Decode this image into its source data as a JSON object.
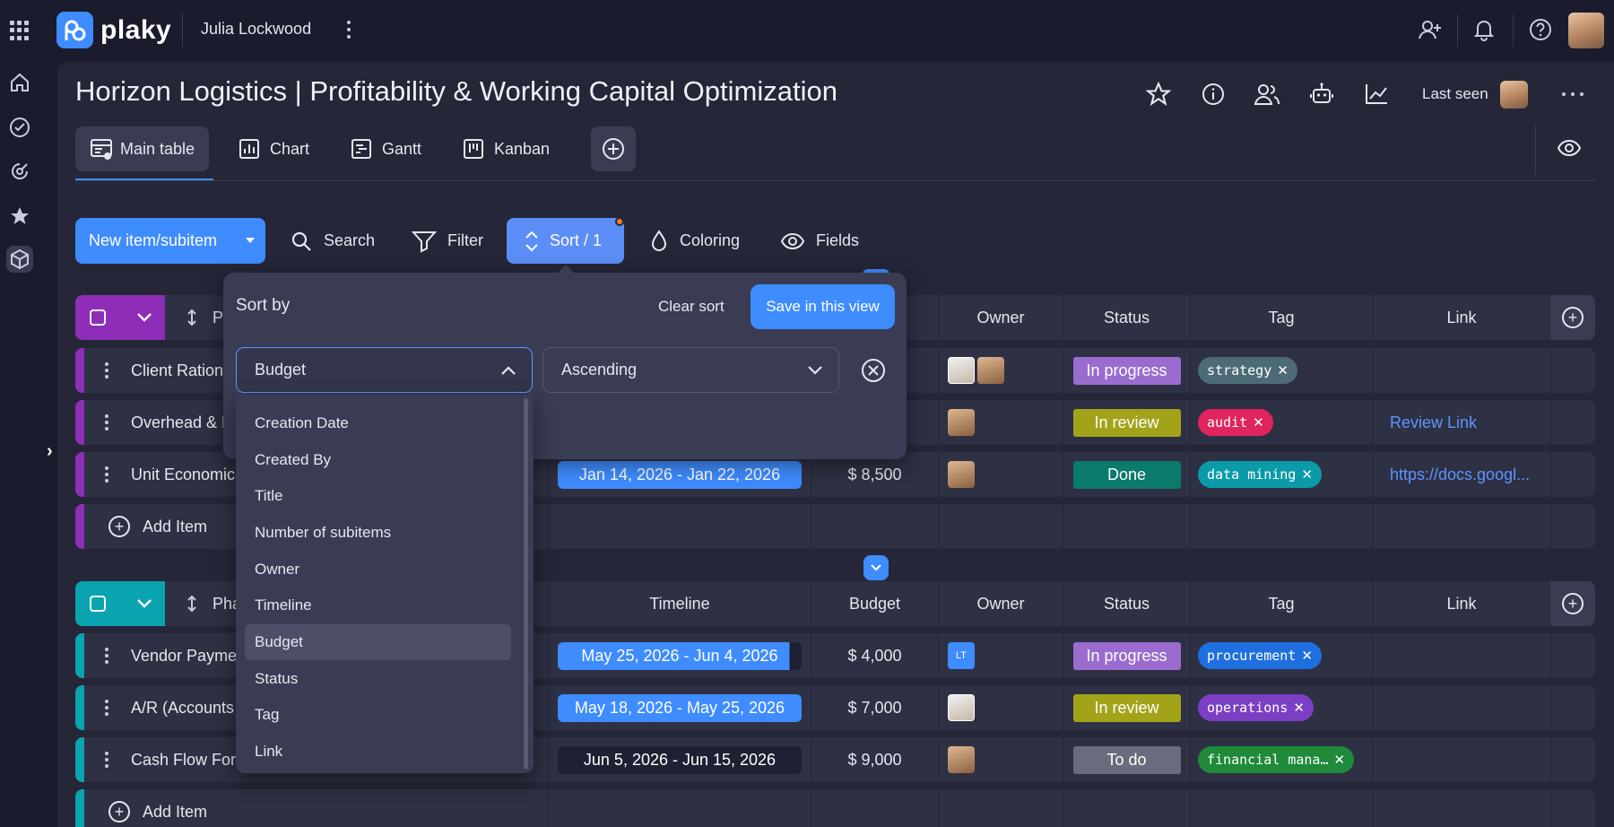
{
  "app": {
    "name": "plaky",
    "workspace": "Julia Lockwood"
  },
  "board": {
    "title": "Horizon Logistics | Profitability & Working Capital Optimization",
    "last_seen_label": "Last seen"
  },
  "tabs": [
    {
      "label": "Main table"
    },
    {
      "label": "Chart"
    },
    {
      "label": "Gantt"
    },
    {
      "label": "Kanban"
    }
  ],
  "toolbar": {
    "new_item": "New item/subitem",
    "search": "Search",
    "filter": "Filter",
    "sort": "Sort / 1",
    "coloring": "Coloring",
    "fields": "Fields"
  },
  "sort_popup": {
    "title": "Sort by",
    "clear": "Clear sort",
    "save": "Save in this view",
    "field_value": "Budget",
    "order_value": "Ascending",
    "options": [
      "Creation Date",
      "Created By",
      "Title",
      "Number of subitems",
      "Owner",
      "Timeline",
      "Budget",
      "Status",
      "Tag",
      "Link"
    ],
    "selected_option": "Budget"
  },
  "groups": [
    {
      "color": "#8e2db8",
      "header_name": "P",
      "columns": {
        "owner": "Owner",
        "status": "Status",
        "tag": "Tag",
        "link": "Link"
      },
      "rows": [
        {
          "name": "Client Rationa",
          "timeline": "",
          "budget": "",
          "status": "In progress",
          "status_color": "#9a6ccf",
          "tag": "strategy",
          "tag_color": "#4d6b76",
          "link": ""
        },
        {
          "name": "Overhead & F",
          "timeline": "",
          "budget": "",
          "status": "In review",
          "status_color": "#a3a31a",
          "tag": "audit",
          "tag_color": "#e0245e",
          "link": "Review Link"
        },
        {
          "name": "Unit Economic",
          "timeline": "Jan 14, 2026 - Jan 22, 2026",
          "budget": "$ 8,500",
          "status": "Done",
          "status_color": "#0a7a6a",
          "tag": "data mining",
          "tag_color": "#0a9aa8",
          "link": "https://docs.googl..."
        }
      ],
      "add_item": "Add Item"
    },
    {
      "color": "#0aa3b0",
      "header_name": "Pha",
      "columns": {
        "timeline": "Timeline",
        "budget": "Budget",
        "owner": "Owner",
        "status": "Status",
        "tag": "Tag",
        "link": "Link"
      },
      "rows": [
        {
          "name": "Vendor Payme",
          "timeline": "May 25, 2026 - Jun 4, 2026",
          "budget": "$ 4,000",
          "owner_initials": "LT",
          "status": "In progress",
          "status_color": "#9a6ccf",
          "tag": "procurement",
          "tag_color": "#1f6fe0"
        },
        {
          "name": "A/R (Accounts",
          "timeline": "May 18, 2026 - May 25, 2026",
          "budget": "$ 7,000",
          "status": "In review",
          "status_color": "#a3a31a",
          "tag": "operations",
          "tag_color": "#7b3fc4"
        },
        {
          "name": "Cash Flow Fore",
          "timeline": "Jun 5, 2026 - Jun 15, 2026",
          "budget": "$ 9,000",
          "status": "To do",
          "status_color": "#6a6c7e",
          "tag": "financial mana…",
          "tag_color": "#1f8a3a"
        }
      ],
      "add_item": "Add Item"
    }
  ]
}
